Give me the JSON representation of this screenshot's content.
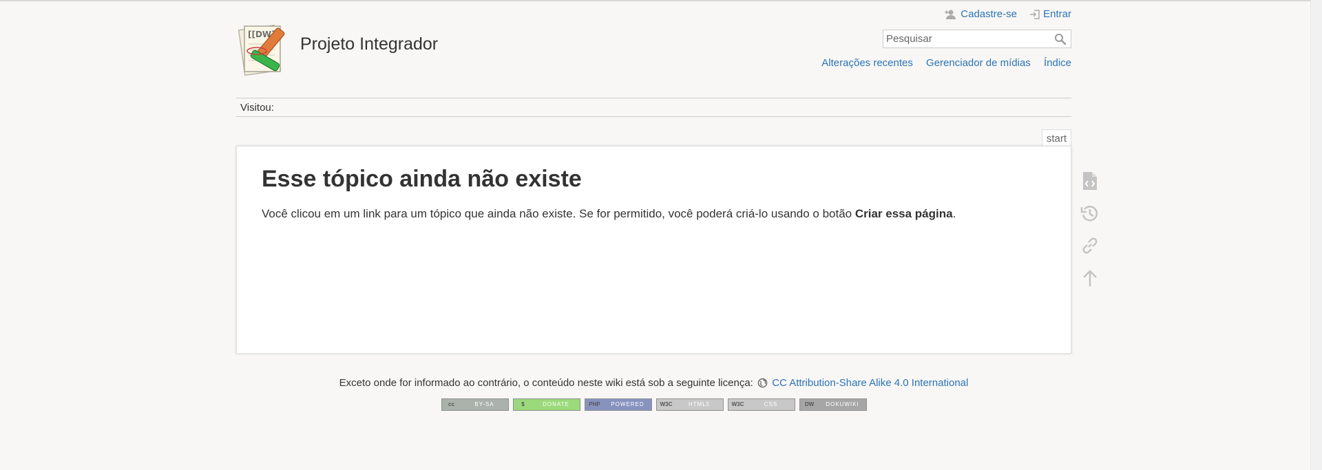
{
  "header": {
    "site_title": "Projeto Integrador",
    "user_tools": {
      "register": "Cadastre-se",
      "login": "Entrar"
    },
    "search": {
      "placeholder": "Pesquisar",
      "value": ""
    },
    "site_tools": {
      "recent": "Alterações recentes",
      "media": "Gerenciador de mídias",
      "index": "Índice"
    }
  },
  "breadcrumbs": {
    "label": "Visitou:"
  },
  "page": {
    "id": "start",
    "title": "Esse tópico ainda não existe",
    "text_before": "Você clicou em um link para um tópico que ainda não existe. Se for permitido, você poderá criá-lo usando o botão ",
    "text_bold": "Criar essa página",
    "text_after": "."
  },
  "page_tools": [
    "create-page-icon",
    "old-revisions-icon",
    "backlinks-icon",
    "back-to-top-icon"
  ],
  "footer": {
    "license_text": "Exceto onde for informado ao contrário, o conteúdo neste wiki está sob a seguinte licença:",
    "license_link": "CC Attribution-Share Alike 4.0 International",
    "badges": [
      {
        "left": "cc",
        "right": "BY-SA",
        "color": "#aab2ab"
      },
      {
        "left": "$",
        "right": "DONATE",
        "color": "#9bd97b"
      },
      {
        "left": "PHP",
        "right": "POWERED",
        "color": "#8892bf"
      },
      {
        "left": "W3C",
        "right": "HTML5",
        "color": "#c8c8c8"
      },
      {
        "left": "W3C",
        "right": "CSS",
        "color": "#c8c8c8"
      },
      {
        "left": "DW",
        "right": "DOKUWIKI",
        "color": "#a6a6a6"
      }
    ]
  },
  "colors": {
    "link": "#2b73b7",
    "background": "#f8f7f5",
    "icon_grey": "#c4c4c4"
  }
}
